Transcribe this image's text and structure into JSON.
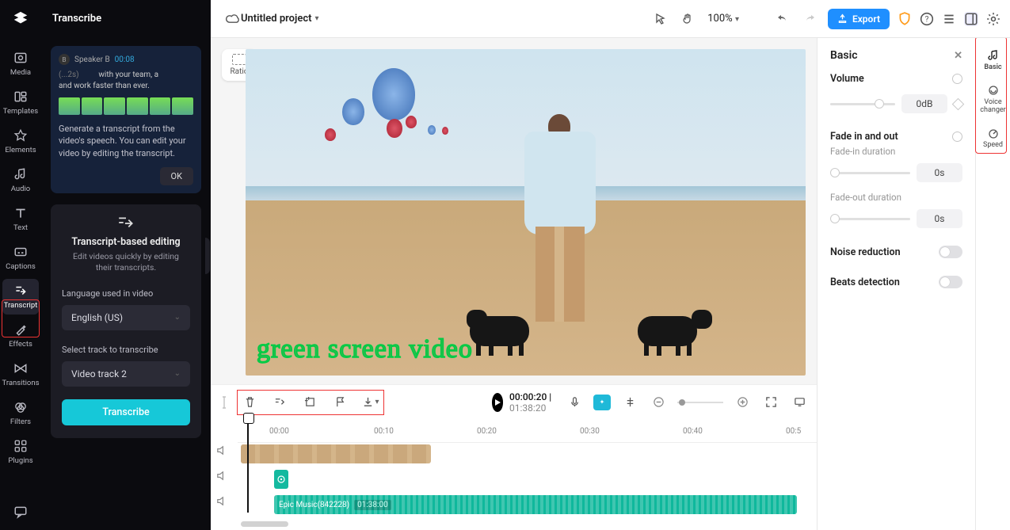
{
  "header": {
    "panel_title": "Transcribe",
    "project_name": "Untitled project",
    "zoom": "100%",
    "export_label": "Export"
  },
  "nav": {
    "items": [
      {
        "label": "Media"
      },
      {
        "label": "Templates"
      },
      {
        "label": "Elements"
      },
      {
        "label": "Audio"
      },
      {
        "label": "Text"
      },
      {
        "label": "Captions"
      },
      {
        "label": "Transcript"
      },
      {
        "label": "Effects"
      },
      {
        "label": "Transitions"
      },
      {
        "label": "Filters"
      },
      {
        "label": "Plugins"
      }
    ]
  },
  "tip_card": {
    "speaker_label": "Speaker B",
    "speaker_time": "00:08",
    "snippet_prefix": "(...2s)",
    "snippet_line1": "with your team, a",
    "snippet_line2": "and work faster than ever.",
    "description": "Generate a transcript from the video's speech. You can edit your video by editing the transcript.",
    "ok": "OK"
  },
  "transcript_card": {
    "title": "Transcript-based editing",
    "subtitle": "Edit videos quickly by editing their transcripts.",
    "language_label": "Language used in video",
    "language_value": "English (US)",
    "track_label": "Select track to transcribe",
    "track_value": "Video track 2",
    "button": "Transcribe"
  },
  "preview": {
    "ratio_label": "Ratio",
    "caption_overlay": "green screen video"
  },
  "transport": {
    "current": "00:00:20",
    "duration": "01:38:20"
  },
  "timeline": {
    "ticks": [
      "00:00",
      "00:10",
      "00:20",
      "00:30",
      "00:40",
      "00:5"
    ],
    "audio_clip_name": "Epic Music(842228)",
    "audio_clip_duration": "01:38:00"
  },
  "basic_panel": {
    "title": "Basic",
    "volume_label": "Volume",
    "volume_value": "0dB",
    "fade_label": "Fade in and out",
    "fade_in_label": "Fade-in duration",
    "fade_in_value": "0s",
    "fade_out_label": "Fade-out duration",
    "fade_out_value": "0s",
    "noise_label": "Noise reduction",
    "beats_label": "Beats detection"
  },
  "right_rail": {
    "items": [
      {
        "label": "Basic"
      },
      {
        "label_line1": "Voice",
        "label_line2": "changer"
      },
      {
        "label": "Speed"
      }
    ]
  }
}
